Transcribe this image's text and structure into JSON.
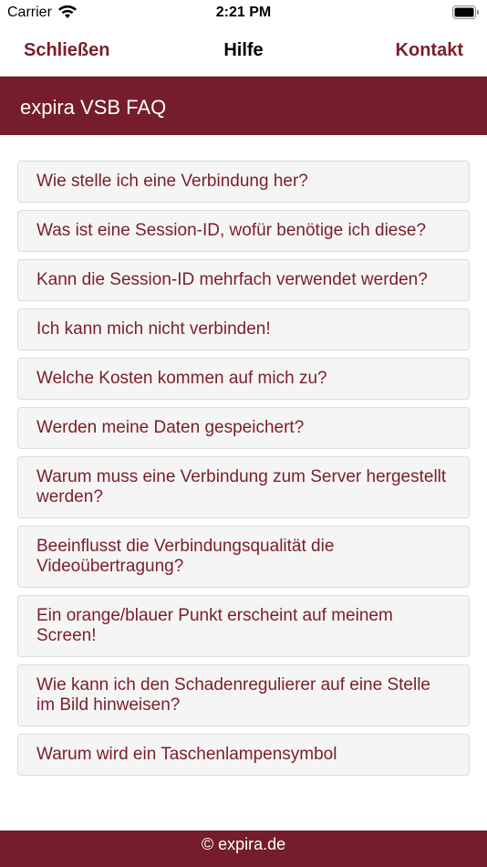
{
  "status_bar": {
    "carrier": "Carrier",
    "time": "2:21 PM",
    "icons": [
      "wifi-icon",
      "battery-icon"
    ]
  },
  "nav_bar": {
    "left_label": "Schließen",
    "title": "Hilfe",
    "right_label": "Kontakt"
  },
  "header": {
    "title": "expira VSB FAQ"
  },
  "faq": {
    "items": [
      "Wie stelle ich eine Verbindung her?",
      "Was ist eine Session-ID, wofür benötige ich diese?",
      "Kann die Session-ID mehrfach verwendet werden?",
      "Ich kann mich nicht verbinden!",
      "Welche Kosten kommen auf mich zu?",
      "Werden meine Daten gespeichert?",
      "Warum muss eine Verbindung zum Server hergestellt werden?",
      "Beeinflusst die Verbindungsqualität die Videoübertragung?",
      "Ein orange/blauer Punkt erscheint auf meinem Screen!",
      "Wie kann ich den Schadenregulierer auf eine Stelle im Bild hinweisen?",
      "Warum wird ein Taschenlampensymbol"
    ]
  },
  "footer": {
    "text": "© expira.de"
  },
  "colors": {
    "brand": "#751d2a",
    "link": "#7a1e2a",
    "item_background": "#f5f5f5"
  }
}
